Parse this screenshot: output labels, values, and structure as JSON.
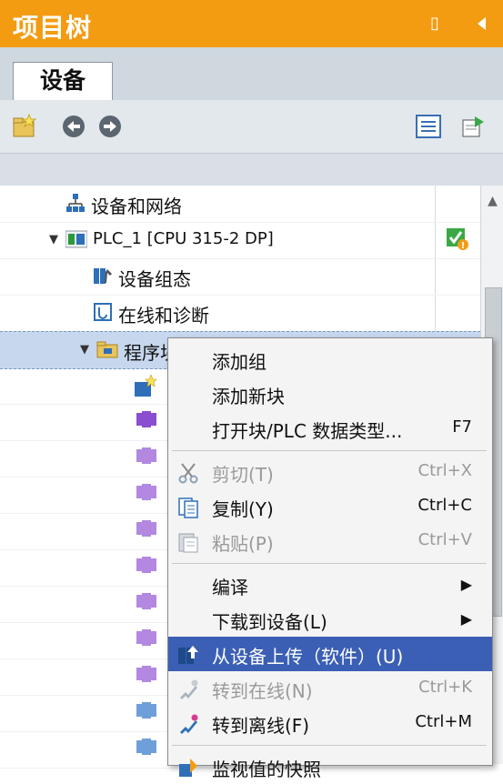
{
  "panel": {
    "title": "项目树"
  },
  "tabs": [
    {
      "label": "设备"
    }
  ],
  "tree": {
    "items": [
      {
        "label": "设备和网络"
      },
      {
        "label": "PLC_1 [CPU 315-2 DP]"
      },
      {
        "label": "设备组态"
      },
      {
        "label": "在线和诊断"
      },
      {
        "label": "程序块"
      }
    ]
  },
  "context_menu": {
    "items": [
      {
        "label": "添加组",
        "shortcut": ""
      },
      {
        "label": "添加新块",
        "shortcut": ""
      },
      {
        "label": "打开块/PLC 数据类型...",
        "shortcut": "F7"
      },
      {
        "label": "剪切(T)",
        "shortcut": "Ctrl+X"
      },
      {
        "label": "复制(Y)",
        "shortcut": "Ctrl+C"
      },
      {
        "label": "粘贴(P)",
        "shortcut": "Ctrl+V"
      },
      {
        "label": "编译",
        "shortcut": ""
      },
      {
        "label": "下载到设备(L)",
        "shortcut": ""
      },
      {
        "label": "从设备上传（软件）(U)",
        "shortcut": ""
      },
      {
        "label": "转到在线(N)",
        "shortcut": "Ctrl+K"
      },
      {
        "label": "转到离线(F)",
        "shortcut": "Ctrl+M"
      },
      {
        "label": "监视值的快照",
        "shortcut": ""
      }
    ]
  },
  "colors": {
    "title_bar": "#f39c12",
    "highlight": "#3b5fb5",
    "selection": "#c7d8ee"
  }
}
